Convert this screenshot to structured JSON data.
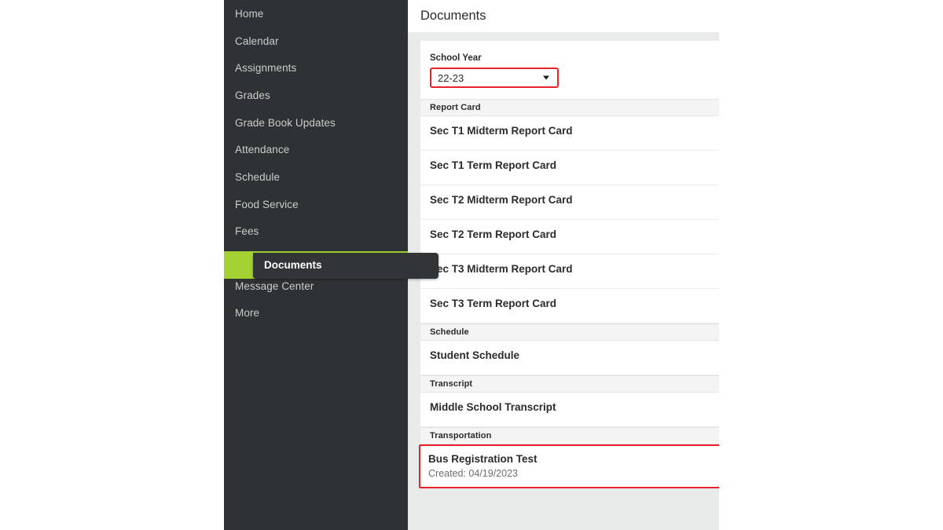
{
  "app": {
    "accent_green": "#a4d233",
    "sidebar_bg": "#2f3234",
    "highlight_red": "#e8222b"
  },
  "sidebar": {
    "items": [
      {
        "label": "Home",
        "active": false
      },
      {
        "label": "Calendar",
        "active": false
      },
      {
        "label": "Assignments",
        "active": false
      },
      {
        "label": "Grades",
        "active": false
      },
      {
        "label": "Grade Book Updates",
        "active": false
      },
      {
        "label": "Attendance",
        "active": false
      },
      {
        "label": "Schedule",
        "active": false
      },
      {
        "label": "Food Service",
        "active": false
      },
      {
        "label": "Fees",
        "active": false
      },
      {
        "label": "Documents",
        "active": true
      },
      {
        "label": "Message Center",
        "active": false
      },
      {
        "label": "More",
        "active": false
      }
    ],
    "active_label": "Documents"
  },
  "header": {
    "title": "Documents"
  },
  "filter": {
    "label": "School Year",
    "value": "22-23",
    "caret_icon": "chevron-down-icon"
  },
  "sections": [
    {
      "header": "Report Card",
      "rows": [
        {
          "title": "Sec T1 Midterm Report Card",
          "sub": "",
          "highlighted": false
        },
        {
          "title": "Sec T1 Term Report Card",
          "sub": "",
          "highlighted": false
        },
        {
          "title": "Sec T2 Midterm Report Card",
          "sub": "",
          "highlighted": false
        },
        {
          "title": "Sec T2 Term Report Card",
          "sub": "",
          "highlighted": false
        },
        {
          "title": "Sec T3 Midterm Report Card",
          "sub": "",
          "highlighted": false
        },
        {
          "title": "Sec T3 Term Report Card",
          "sub": "",
          "highlighted": false
        }
      ]
    },
    {
      "header": "Schedule",
      "rows": [
        {
          "title": "Student Schedule",
          "sub": "",
          "highlighted": false
        }
      ]
    },
    {
      "header": "Transcript",
      "rows": [
        {
          "title": "Middle School Transcript",
          "sub": "",
          "highlighted": false
        }
      ]
    },
    {
      "header": "Transportation",
      "rows": [
        {
          "title": "Bus Registration Test",
          "sub": "Created: 04/19/2023",
          "highlighted": true
        }
      ]
    }
  ]
}
